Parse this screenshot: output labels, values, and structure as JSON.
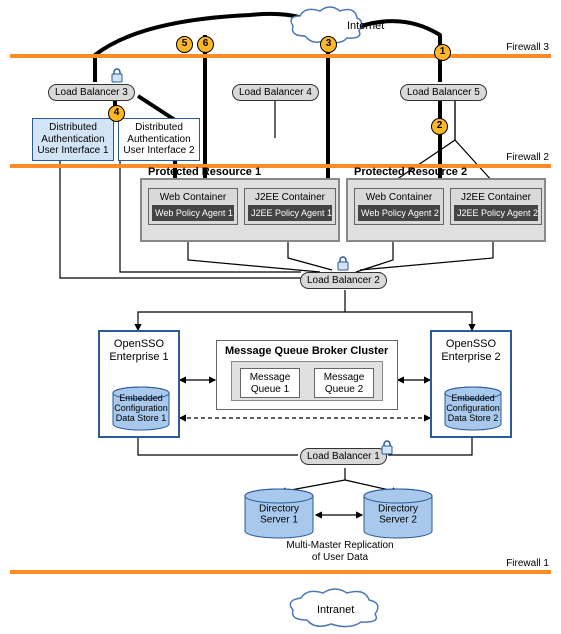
{
  "internet_label": "Internet",
  "intranet_label": "Intranet",
  "firewalls": {
    "fw1": "Firewall 1",
    "fw2": "Firewall 2",
    "fw3": "Firewall 3"
  },
  "load_balancers": {
    "lb1": "Load Balancer 1",
    "lb2": "Load Balancer 2",
    "lb3": "Load Balancer 3",
    "lb4": "Load Balancer 4",
    "lb5": "Load Balancer 5"
  },
  "daui": {
    "d1": "Distributed\nAuthentication\nUser Interface 1",
    "d2": "Distributed\nAuthentication\nUser Interface 2"
  },
  "protected": {
    "p1": {
      "title": "Protected Resource 1",
      "web_container": "Web Container",
      "web_agent": "Web Policy Agent 1",
      "j2ee_container": "J2EE Container",
      "j2ee_agent": "J2EE Policy Agent 1"
    },
    "p2": {
      "title": "Protected Resource 2",
      "web_container": "Web Container",
      "web_agent": "Web Policy Agent 2",
      "j2ee_container": "J2EE Container",
      "j2ee_agent": "J2EE Policy Agent 2"
    }
  },
  "opensso": {
    "o1": {
      "title": "OpenSSO\nEnterprise 1",
      "store": "Embedded\nConfiguration\nData Store 1"
    },
    "o2": {
      "title": "OpenSSO\nEnterprise 2",
      "store": "Embedded\nConfiguration\nData Store 2"
    }
  },
  "mqbc": {
    "title": "Message Queue Broker Cluster",
    "mq1": "Message\nQueue 1",
    "mq2": "Message\nQueue 2"
  },
  "directory": {
    "ds1": "Directory\nServer 1",
    "ds2": "Directory\nServer 2",
    "caption": "Multi-Master Replication\nof User Data"
  },
  "steps": {
    "s1": "1",
    "s2": "2",
    "s3": "3",
    "s4": "4",
    "s5": "5",
    "s6": "6"
  }
}
